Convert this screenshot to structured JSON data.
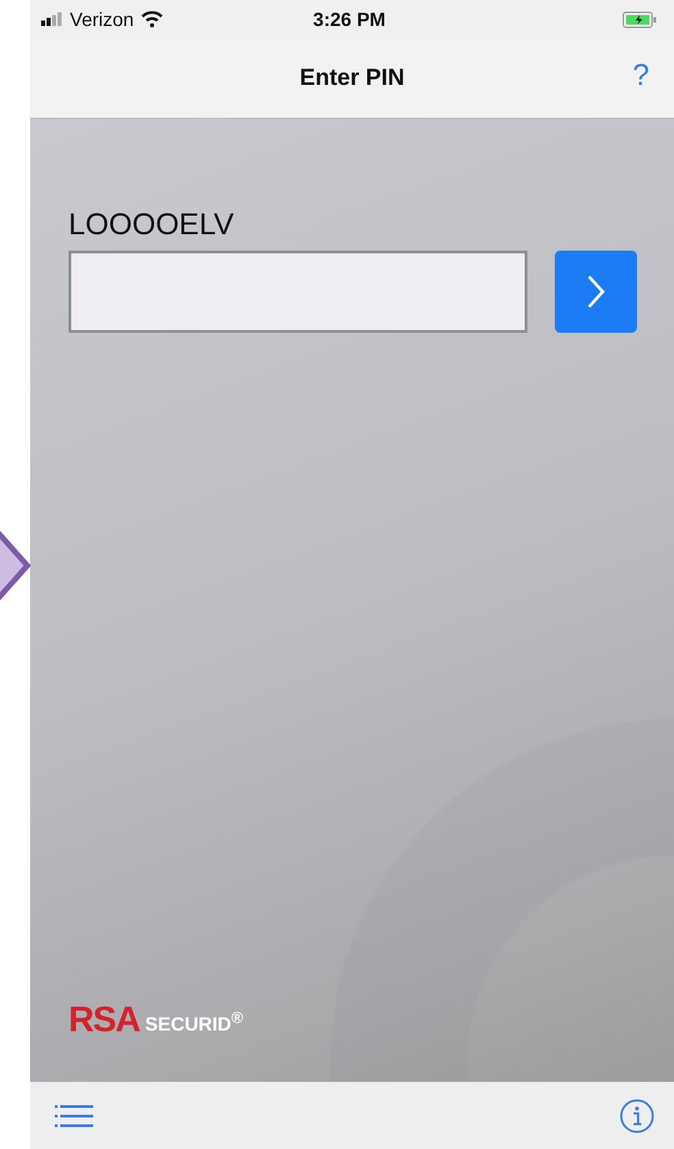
{
  "status_bar": {
    "carrier": "Verizon",
    "time": "3:26 PM"
  },
  "nav_bar": {
    "title": "Enter PIN",
    "help": "?"
  },
  "pin_form": {
    "token_label": "LOOOOELV"
  },
  "logo": {
    "brand": "RSA",
    "product": "SECURID$^{®}$"
  }
}
